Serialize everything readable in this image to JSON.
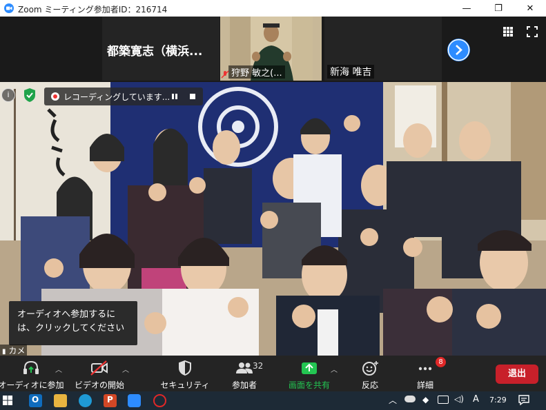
{
  "window": {
    "title": "Zoom ミーティング参加者ID：216714",
    "minimize": "—",
    "maximize": "❐",
    "close": "✕"
  },
  "gallery": {
    "tile1_name": "都築寛志（横浜...",
    "tile2_name": "狩野 敏之(...",
    "tile3_name": "新海 唯吉"
  },
  "recording": {
    "text": "レコーディングしています..."
  },
  "audio_tip": {
    "text": "オーディオへ参加するには、クリックしてください"
  },
  "camera_label": "カメ",
  "toolbar": {
    "audio_label": "オーディオに参加",
    "video_label": "ビデオの開始",
    "security_label": "セキュリティ",
    "participants_label": "参加者",
    "participants_count": "32",
    "share_label": "画面を共有",
    "reactions_label": "反応",
    "more_label": "詳細",
    "more_badge": "8",
    "leave_label": "退出",
    "share_color": "#23c552",
    "leave_color": "#e02828"
  },
  "taskbar": {
    "time": "7:29",
    "ime": "A"
  }
}
